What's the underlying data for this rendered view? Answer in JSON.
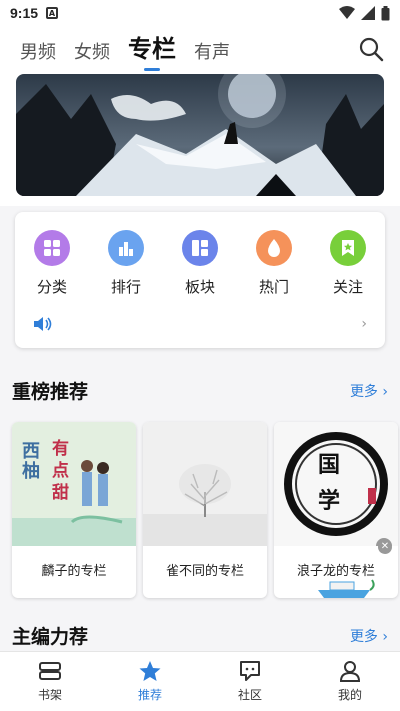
{
  "status": {
    "time": "9:15",
    "a_icon": "A"
  },
  "top_tabs": [
    {
      "label": "男频"
    },
    {
      "label": "女频"
    },
    {
      "label": "专栏"
    },
    {
      "label": "有声"
    }
  ],
  "menu": [
    {
      "label": "分类",
      "icon": "grid-icon",
      "color": "#b37be8"
    },
    {
      "label": "排行",
      "icon": "bar-chart-icon",
      "color": "#6aa3ef"
    },
    {
      "label": "板块",
      "icon": "layout-icon",
      "color": "#6b84ea"
    },
    {
      "label": "热门",
      "icon": "flame-icon",
      "color": "#f5925a"
    },
    {
      "label": "关注",
      "icon": "bookmark-star-icon",
      "color": "#78cf3a"
    }
  ],
  "section1": {
    "title": "重榜推荐",
    "more": "更多"
  },
  "books": [
    {
      "title": "麟子的专栏",
      "cover_text_1": "西柚",
      "cover_text_2": "有点甜"
    },
    {
      "title": "雀不同的专栏"
    },
    {
      "title": "浪子龙的专栏",
      "cover_text": "国学"
    }
  ],
  "section2": {
    "title": "主编力荐",
    "more": "更多"
  },
  "bottom_nav": [
    {
      "label": "书架",
      "icon": "bookshelf-icon"
    },
    {
      "label": "推荐",
      "icon": "star-icon",
      "badge": "推荐"
    },
    {
      "label": "社区",
      "icon": "chat-icon"
    },
    {
      "label": "我的",
      "icon": "user-icon"
    }
  ],
  "colors": {
    "accent": "#2f7ed8"
  }
}
